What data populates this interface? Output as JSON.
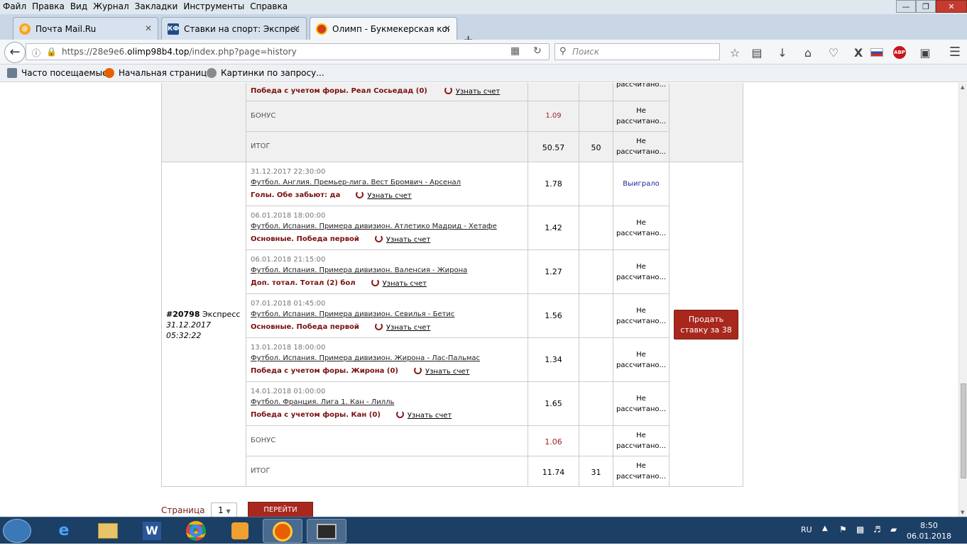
{
  "menu": [
    "Файл",
    "Правка",
    "Вид",
    "Журнал",
    "Закладки",
    "Инструменты",
    "Справка"
  ],
  "tabs": [
    {
      "title": "Почта Mail.Ru",
      "fav_text": "@",
      "fav_color": "#f5a623"
    },
    {
      "title": "Ставки на спорт: Экспресс",
      "fav_text": "КФ",
      "fav_color": "#1e4d8a"
    },
    {
      "title": "Олимп - Букмекерская конт",
      "fav_text": "",
      "fav_color": "#d63a1a"
    }
  ],
  "url": {
    "prefix": "https://28e9e6.",
    "domain": "olimp98b4.top",
    "path": "/index.php?page=history"
  },
  "search": {
    "placeholder": "Поиск"
  },
  "bookmarks": [
    "Часто посещаемые",
    "Начальная страница",
    "Картинки по запросу..."
  ],
  "common": {
    "learn": "Узнать счет",
    "not_calc_1": "Не",
    "not_calc_2": "рассчитано..."
  },
  "prev": {
    "bet_label": "Победа с учетом форы. Реал Сосьедад (0)",
    "bonus_label": "БОНУС",
    "bonus_coef": "1.09",
    "total_label": "ИТОГ",
    "total_coef": "50.57",
    "total_sum": "50"
  },
  "coupon": {
    "number": "#20798",
    "type": "Экспресс",
    "date": "31.12.2017",
    "time": "05:32:22",
    "sell_label": "Продать ставку за 38",
    "rows": [
      {
        "date": "31.12.2017 22:30:00",
        "event": "Футбол. Англия. Премьер-лига. Вест Бромвич - Арсенал",
        "bet": "Голы. Обе забьют: да",
        "coef": "1.78",
        "status": "Выиграло"
      },
      {
        "date": "06.01.2018 18:00:00",
        "event": "Футбол. Испания. Примера дивизион. Атлетико Мадрид - Хетафе",
        "bet": "Основные. Победа первой",
        "coef": "1.42",
        "status": ""
      },
      {
        "date": "06.01.2018 21:15:00",
        "event": "Футбол. Испания. Примера дивизион. Валенсия - Жирона",
        "bet": "Доп. тотал. Тотал (2) бол",
        "coef": "1.27",
        "status": ""
      },
      {
        "date": "07.01.2018 01:45:00",
        "event": "Футбол. Испания. Примера дивизион. Севилья - Бетис",
        "bet": "Основные. Победа первой",
        "coef": "1.56",
        "status": ""
      },
      {
        "date": "13.01.2018 18:00:00",
        "event": "Футбол. Испания. Примера дивизион. Жирона - Лас-Пальмас",
        "bet": "Победа с учетом форы. Жирона (0)",
        "coef": "1.34",
        "status": ""
      },
      {
        "date": "14.01.2018 01:00:00",
        "event": "Футбол. Франция. Лига 1. Кан - Лилль",
        "bet": "Победа с учетом форы. Кан (0)",
        "coef": "1.65",
        "status": ""
      }
    ],
    "bonus_label": "БОНУС",
    "bonus_coef": "1.06",
    "total_label": "ИТОГ",
    "total_coef": "11.74",
    "total_sum": "31"
  },
  "pager": {
    "label": "Страница",
    "page": "1",
    "go": "ПЕРЕЙТИ"
  },
  "taskbar": {
    "lang": "RU",
    "time": "8:50",
    "date": "06.01.2018"
  }
}
